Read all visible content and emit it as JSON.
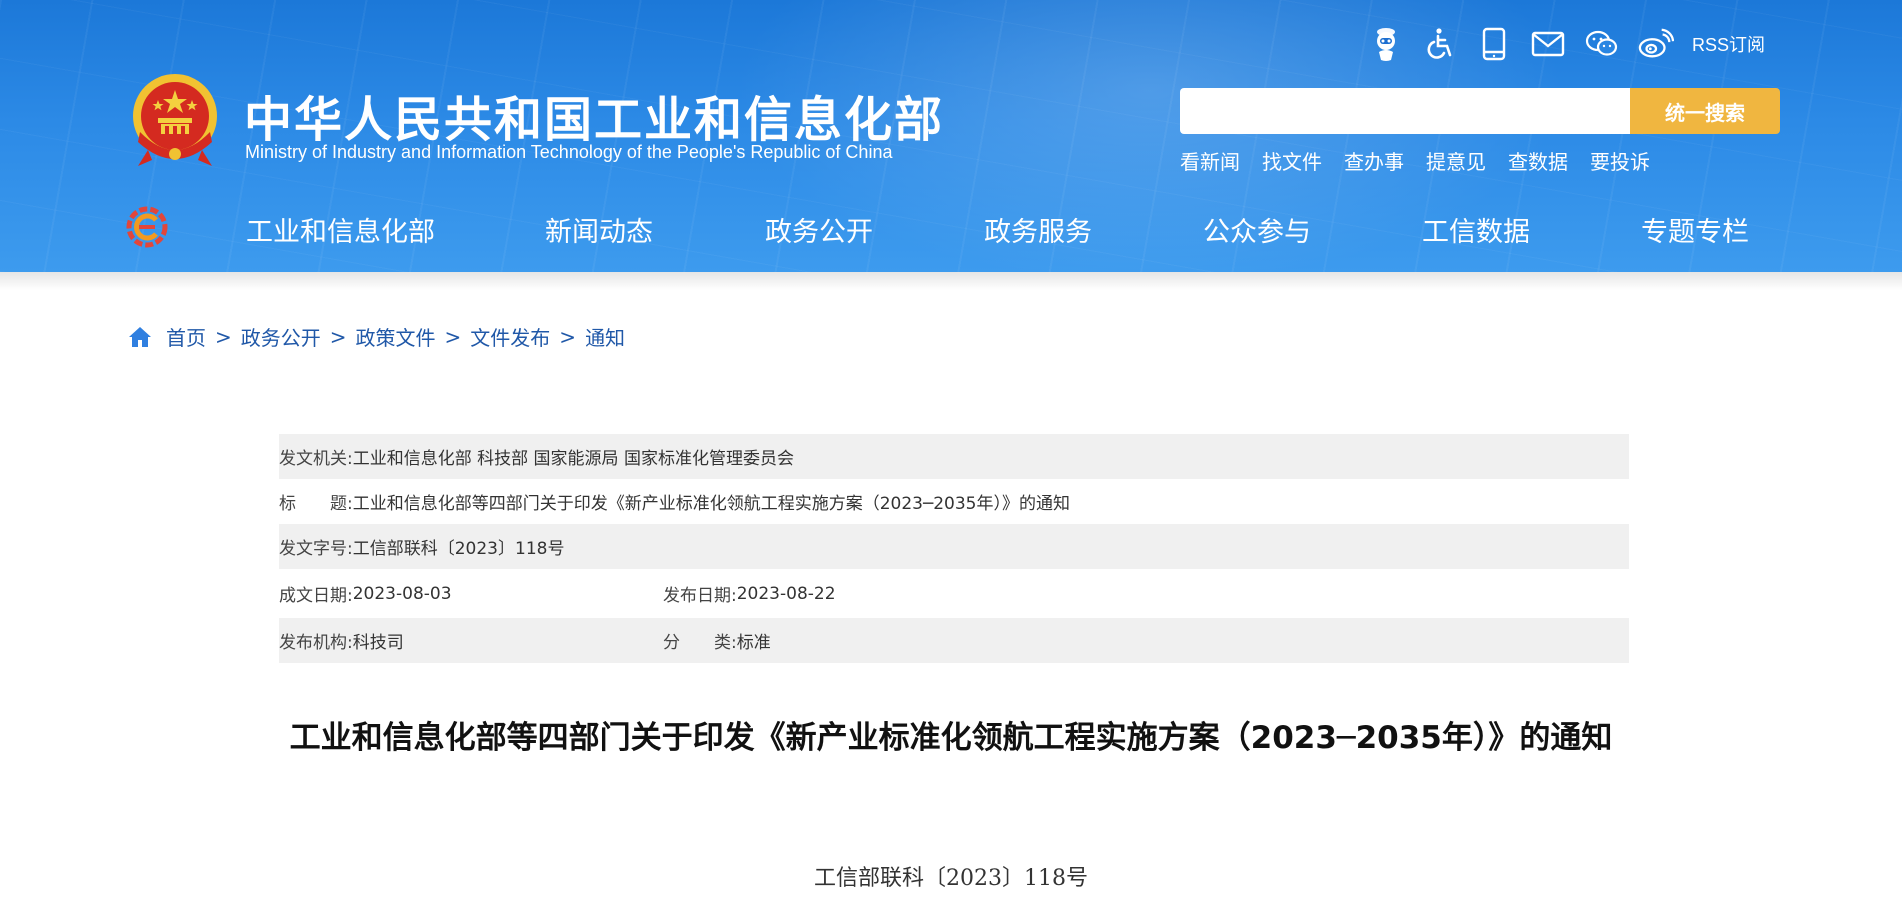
{
  "header": {
    "site_title": "中华人民共和国工业和信息化部",
    "site_subtitle": "Ministry of Industry and Information Technology of the People's Republic of China",
    "rss_label": "RSS订阅",
    "search": {
      "placeholder": "",
      "button_label": "统一搜索"
    },
    "quick_links": [
      "看新闻",
      "找文件",
      "查办事",
      "提意见",
      "查数据",
      "要投诉"
    ],
    "icons": [
      "robot-assistant-icon",
      "accessibility-icon",
      "mobile-icon",
      "mail-icon",
      "wechat-icon",
      "weibo-icon"
    ],
    "colors": {
      "header_bg": "#2c8ae6",
      "search_button": "#f0b640"
    }
  },
  "nav": {
    "items": [
      "工业和信息化部",
      "新闻动态",
      "政务公开",
      "政务服务",
      "公众参与",
      "工信数据",
      "专题专栏"
    ]
  },
  "breadcrumb": [
    "首页",
    "政务公开",
    "政策文件",
    "文件发布",
    "通知"
  ],
  "meta": {
    "issuer_label": "发文机关:",
    "issuer_value": "工业和信息化部 科技部 国家能源局 国家标准化管理委员会",
    "title_label": "标　　题:",
    "title_value": "工业和信息化部等四部门关于印发《新产业标准化领航工程实施方案（2023─2035年）》的通知",
    "doc_no_label": "发文字号:",
    "doc_no_value": "工信部联科〔2023〕118号",
    "created_label": "成文日期:",
    "created_value": "2023-08-03",
    "published_label": "发布日期:",
    "published_value": "2023-08-22",
    "org_label": "发布机构:",
    "org_value": "科技司",
    "category_label": "分　　类:",
    "category_value": "标准"
  },
  "article": {
    "title": "工业和信息化部等四部门关于印发《新产业标准化领航工程实施方案（2023─2035年）》的通知",
    "doc_number": "工信部联科〔2023〕118号"
  }
}
